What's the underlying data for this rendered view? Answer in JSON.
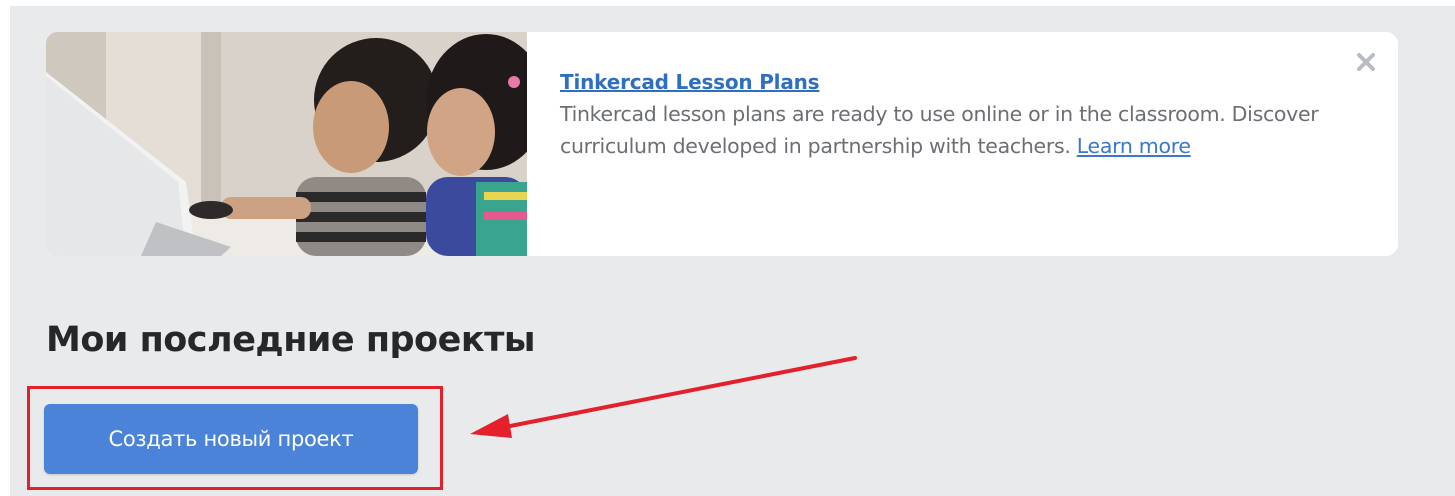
{
  "banner": {
    "title": "Tinkercad Lesson Plans",
    "description": "Tinkercad lesson plans are ready to use online or in the classroom. Discover curriculum developed in partnership with teachers.",
    "learn_more": "Learn more",
    "image_icon": "children-at-laptop-photo",
    "close_icon": "close-icon"
  },
  "recent_projects": {
    "title": "Мои последние проекты",
    "create_button_label": "Создать новый проект"
  },
  "annotation": {
    "highlight_color": "#e3202b",
    "arrow_icon": "arrow-left-icon"
  },
  "colors": {
    "background": "#e9eaec",
    "button": "#4b83d8",
    "link": "#2f6fc0"
  }
}
